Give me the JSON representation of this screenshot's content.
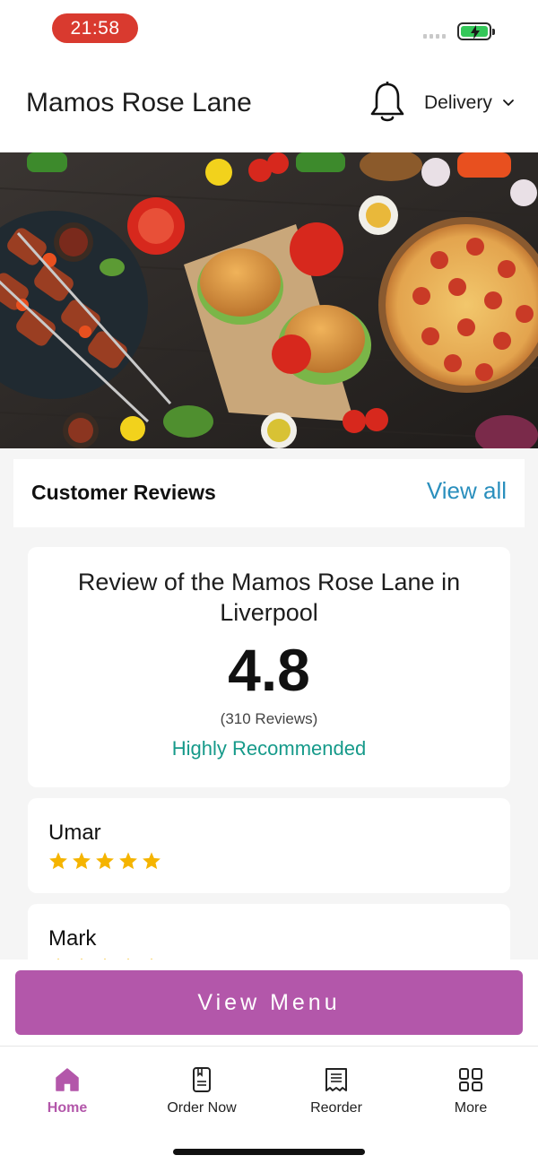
{
  "status_bar": {
    "time": "21:58"
  },
  "header": {
    "title": "Mamos Rose Lane",
    "mode_label": "Delivery"
  },
  "reviews": {
    "section_title": "Customer Reviews",
    "view_all_label": "View all",
    "summary": {
      "title": "Review of the Mamos Rose Lane in Liverpool",
      "score": "4.8",
      "count": "(310 Reviews)",
      "label": "Highly Recommended"
    },
    "items": [
      {
        "name": "Umar",
        "rating": 5
      },
      {
        "name": "Mark",
        "rating": 5
      }
    ]
  },
  "menu_button": {
    "label": "View Menu"
  },
  "tabbar": {
    "tabs": [
      {
        "label": "Home",
        "icon": "home-icon",
        "active": true
      },
      {
        "label": "Order Now",
        "icon": "order-icon",
        "active": false
      },
      {
        "label": "Reorder",
        "icon": "receipt-icon",
        "active": false
      },
      {
        "label": "More",
        "icon": "grid-icon",
        "active": false
      }
    ]
  },
  "colors": {
    "accent": "#b357aa",
    "link": "#2a8fbd",
    "recommend": "#169a8a",
    "star": "#f5b400",
    "time_pill": "#d93a2f"
  }
}
